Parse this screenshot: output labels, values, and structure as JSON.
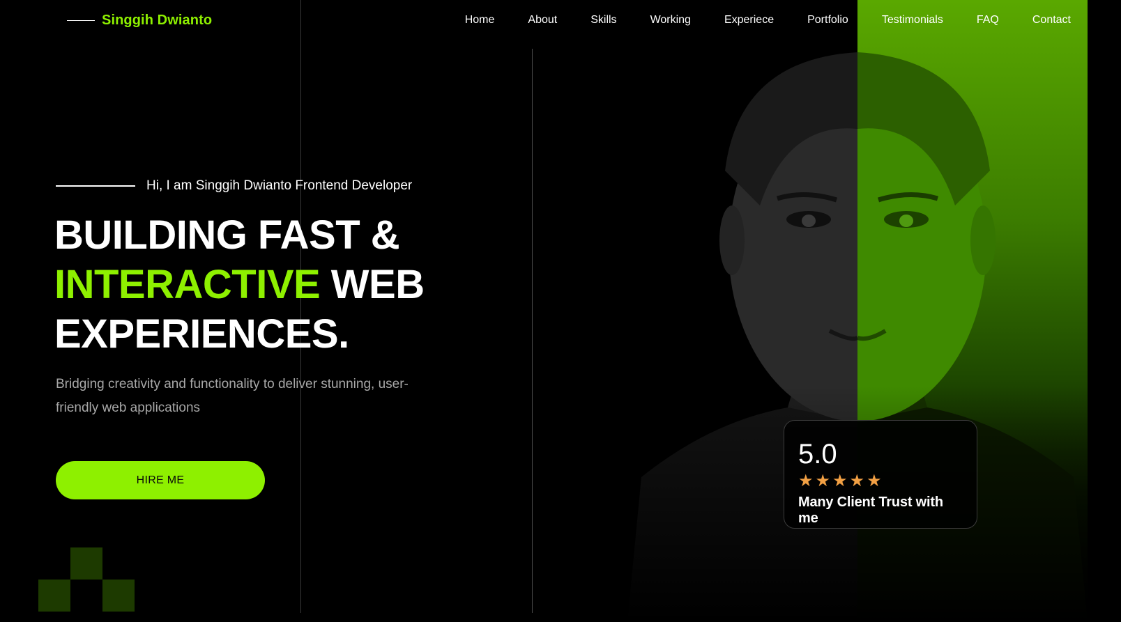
{
  "brand": {
    "name": "Singgih Dwianto"
  },
  "nav": {
    "items": [
      {
        "label": "Home"
      },
      {
        "label": "About"
      },
      {
        "label": "Skills"
      },
      {
        "label": "Working"
      },
      {
        "label": "Experiece"
      },
      {
        "label": "Portfolio"
      },
      {
        "label": "Testimonials"
      },
      {
        "label": "FAQ"
      },
      {
        "label": "Contact"
      }
    ]
  },
  "hero": {
    "intro": "Hi, I am Singgih Dwianto Frontend Developer",
    "headline_line1": "BUILDING FAST &",
    "headline_accent": "INTERACTIVE",
    "headline_line2_rest": " WEB",
    "headline_line3": "EXPERIENCES.",
    "subtitle": "Bridging creativity and functionality to deliver stunning, user-friendly web applications",
    "cta_label": "HIRE ME"
  },
  "rating": {
    "score": "5.0",
    "stars": 5,
    "caption": "Many Client Trust with me"
  },
  "colors": {
    "accent": "#8ef000",
    "background": "#000000",
    "star": "#f2a044"
  },
  "icons": {
    "star": "star-icon"
  }
}
